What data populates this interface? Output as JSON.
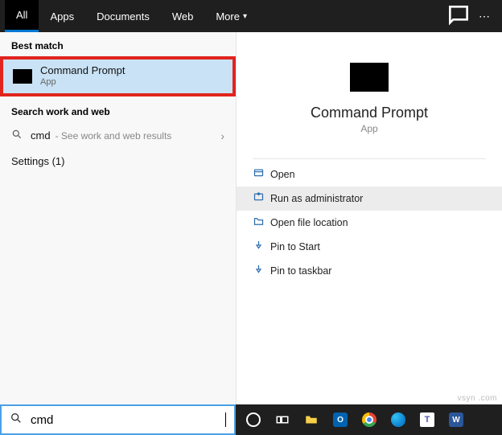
{
  "tabs": {
    "all": "All",
    "apps": "Apps",
    "documents": "Documents",
    "web": "Web",
    "more": "More"
  },
  "left": {
    "best_match_label": "Best match",
    "best_match": {
      "title": "Command Prompt",
      "subtitle": "App"
    },
    "search_section_label": "Search work and web",
    "web": {
      "query": "cmd",
      "hint": "- See work and web results"
    },
    "settings_label": "Settings (1)"
  },
  "preview": {
    "title": "Command Prompt",
    "subtitle": "App",
    "actions": {
      "open": "Open",
      "runadmin": "Run as administrator",
      "openloc": "Open file location",
      "pinstart": "Pin to Start",
      "pintask": "Pin to taskbar"
    }
  },
  "search": {
    "value": "cmd"
  },
  "watermark": "vsyn .com"
}
